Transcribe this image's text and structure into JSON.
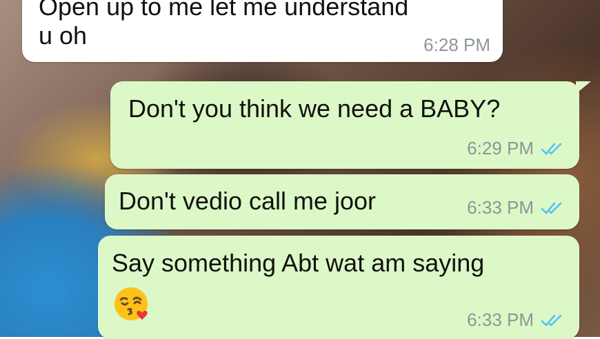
{
  "chat": {
    "messages": [
      {
        "direction": "incoming",
        "text_line1": "Open up to me let me understand",
        "text_line2": "u oh",
        "time": "6:28 PM"
      },
      {
        "direction": "outgoing",
        "text": "Don't you think we need a BABY?",
        "time": "6:29 PM",
        "status_icon": "double-check-icon"
      },
      {
        "direction": "outgoing",
        "text": "Don't vedio call me joor",
        "time": "6:33 PM",
        "status_icon": "double-check-icon"
      },
      {
        "direction": "outgoing",
        "text": "Say something Abt wat am saying",
        "emoji_icon": "face-blowing-kiss-icon",
        "time": "6:33 PM",
        "status_icon": "double-check-icon"
      }
    ]
  },
  "colors": {
    "incoming_bubble": "#ffffff",
    "outgoing_bubble": "#dcf8c6",
    "read_tick_blue": "#4fc3f7",
    "timestamp_gray": "#8d9699"
  }
}
